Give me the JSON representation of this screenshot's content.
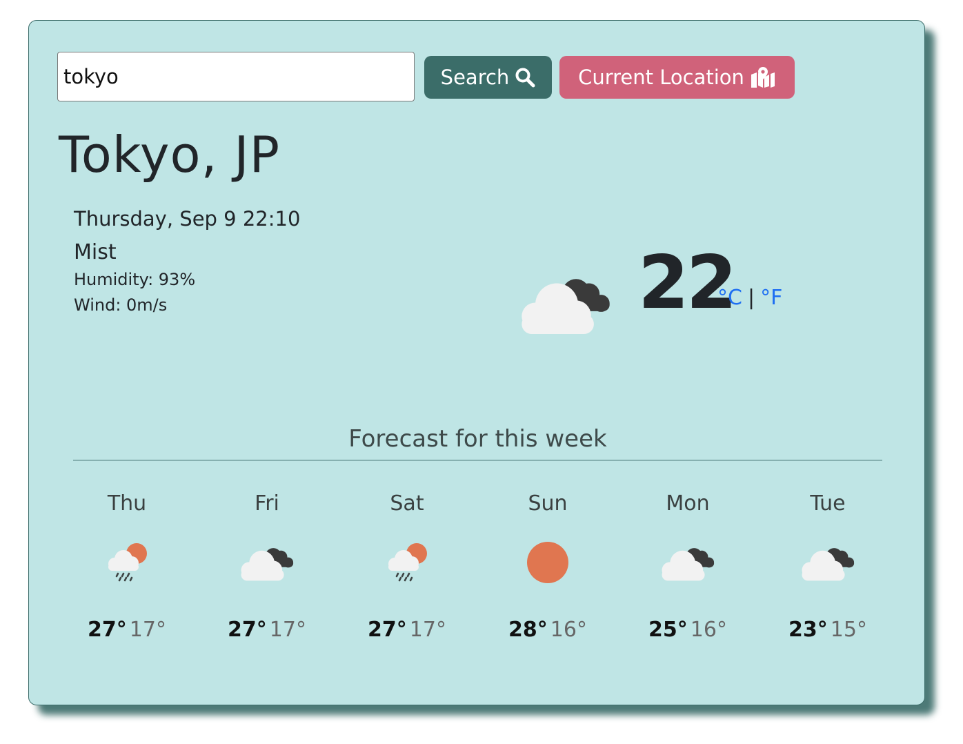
{
  "search": {
    "value": "tokyo",
    "button_label": "Search",
    "location_label": "Current Location"
  },
  "current": {
    "city": "Tokyo, JP",
    "date": "Thursday, Sep 9 22:10",
    "description": "Mist",
    "humidity": "Humidity: 93%",
    "wind": "Wind: 0m/s",
    "temperature": "22",
    "unit_c": "°C",
    "unit_sep": "|",
    "unit_f": "°F",
    "icon": "cloudy-icon"
  },
  "forecast": {
    "title": "Forecast for this week",
    "days": [
      {
        "name": "Thu",
        "icon": "sun-rain-icon",
        "max": "27°",
        "min": "17°"
      },
      {
        "name": "Fri",
        "icon": "cloudy-icon",
        "max": "27°",
        "min": "17°"
      },
      {
        "name": "Sat",
        "icon": "sun-rain-icon",
        "max": "27°",
        "min": "17°"
      },
      {
        "name": "Sun",
        "icon": "sun-icon",
        "max": "28°",
        "min": "16°"
      },
      {
        "name": "Mon",
        "icon": "cloudy-icon",
        "max": "25°",
        "min": "16°"
      },
      {
        "name": "Tue",
        "icon": "cloudy-icon",
        "max": "23°",
        "min": "15°"
      }
    ]
  },
  "colors": {
    "card_bg": "#bfe5e5",
    "search_button": "#3b6d69",
    "location_button": "#d0627a",
    "unit_link": "#1e6ff2",
    "sun": "#e07650"
  }
}
